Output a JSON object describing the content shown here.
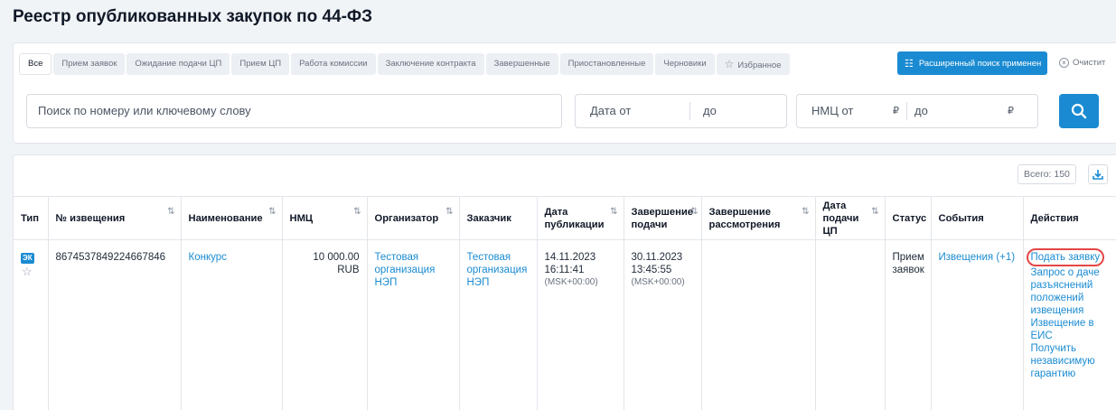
{
  "page_title": "Реестр опубликованных закупок по 44-ФЗ",
  "tabs": [
    {
      "label": "Все",
      "active": true
    },
    {
      "label": "Прием заявок"
    },
    {
      "label": "Ожидание подачи ЦП"
    },
    {
      "label": "Прием ЦП"
    },
    {
      "label": "Работа комиссии"
    },
    {
      "label": "Заключение контракта"
    },
    {
      "label": "Завершенные"
    },
    {
      "label": "Приостановленные"
    },
    {
      "label": "Черновики"
    },
    {
      "label": "Избранное"
    }
  ],
  "toolbar": {
    "advanced_search_label": "Расширенный поиск применен",
    "clear_label": "Очистит"
  },
  "filters": {
    "search_placeholder": "Поиск по номеру или ключевому слову",
    "date_from": "Дата от",
    "date_to": "до",
    "nmc_from": "НМЦ от",
    "nmc_to": "до",
    "currency": "₽"
  },
  "grid": {
    "total_label": "Всего: 150",
    "columns": [
      "Тип",
      "№ извещения",
      "Наименование",
      "НМЦ",
      "Организатор",
      "Заказчик",
      "Дата публикации",
      "Завершение подачи",
      "Завершение рассмотрения",
      "Дата подачи ЦП",
      "Статус",
      "События",
      "Действия"
    ],
    "rows": [
      {
        "type_badge": "ЭК",
        "number": "8674537849224667846",
        "name": "Конкурс",
        "nmc": "10 000.00 RUB",
        "organizer": "Тестовая организация НЭП",
        "customer": "Тестовая организация НЭП",
        "pub_date": "14.11.2023",
        "pub_time": "16:11:41",
        "pub_tz": "(MSK+00:00)",
        "end_date": "30.11.2023",
        "end_time": "13:45:55",
        "end_tz": "(MSK+00:00)",
        "review_end": "",
        "cp_date": "",
        "status": "Прием заявок",
        "events": "Извещения (+1)",
        "actions": [
          "Подать заявку",
          "Запрос о даче разъяснений положений извещения",
          "Извещение в ЕИС",
          "Получить независимую гарантию"
        ]
      }
    ]
  },
  "colors": {
    "accent": "#1a8bd2",
    "highlight": "#e54646"
  }
}
